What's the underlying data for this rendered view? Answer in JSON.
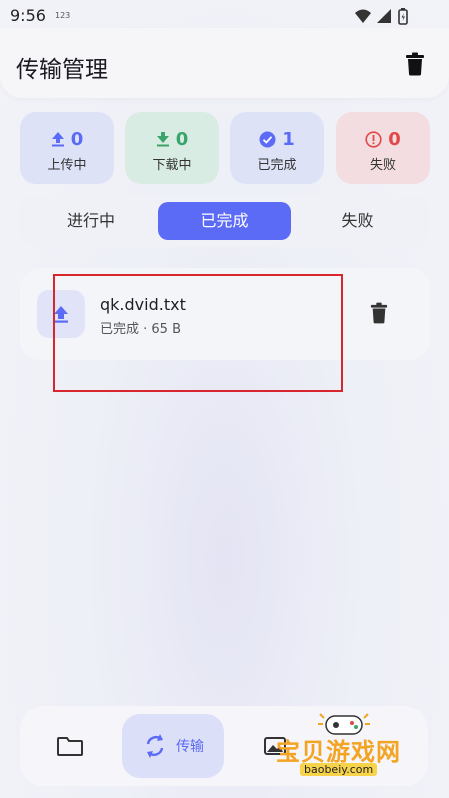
{
  "status_bar": {
    "time": "9:56",
    "notification": "123"
  },
  "app_bar": {
    "title": "传输管理"
  },
  "stats": [
    {
      "count": "0",
      "label": "上传中",
      "color": "#5c6bf5",
      "bg": "#dde2f7",
      "icon": "upload-icon"
    },
    {
      "count": "0",
      "label": "下载中",
      "color": "#3aa56a",
      "bg": "#d9ece3",
      "icon": "download-icon"
    },
    {
      "count": "1",
      "label": "已完成",
      "color": "#5c6bf5",
      "bg": "#dde2f7",
      "icon": "check-circle-icon"
    },
    {
      "count": "0",
      "label": "失败",
      "color": "#e04848",
      "bg": "#f3dde0",
      "icon": "error-circle-icon"
    }
  ],
  "tabs": [
    {
      "label": "进行中",
      "active": false
    },
    {
      "label": "已完成",
      "active": true
    },
    {
      "label": "失败",
      "active": false
    }
  ],
  "transfers": [
    {
      "name": "qk.dvid.txt",
      "meta": "已完成 · 65 B",
      "icon": "upload-icon"
    }
  ],
  "bottom_nav": {
    "items": [
      {
        "icon": "folder-icon"
      },
      {
        "icon": "sync-icon",
        "label": "传输",
        "active": true
      },
      {
        "icon": "image-icon"
      }
    ]
  },
  "watermark": {
    "text": "宝贝游戏网",
    "url": "baobeiy.com"
  },
  "colors": {
    "accent": "#5c6bf5",
    "highlight": "#d8262e"
  }
}
